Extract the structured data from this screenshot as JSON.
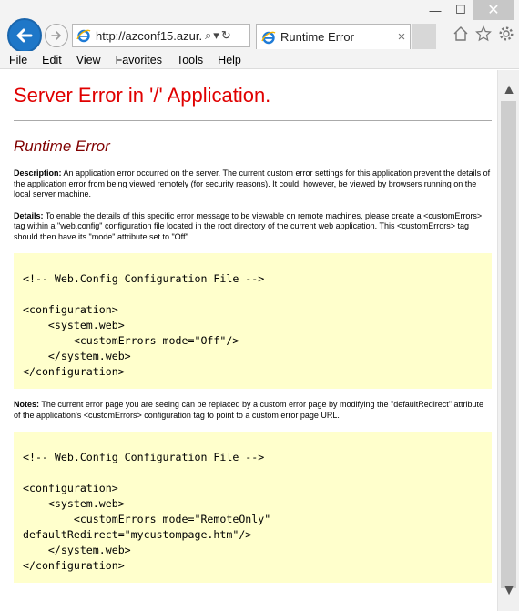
{
  "window": {
    "minimize_glyph": "—",
    "maximize_glyph": "☐",
    "close_glyph": "✕"
  },
  "address_bar": {
    "url": "http://azconf15.azur...",
    "search_glyph": "⌕",
    "dropdown_glyph": "▾",
    "refresh_glyph": "↻"
  },
  "tab": {
    "title": "Runtime Error",
    "close_glyph": "×"
  },
  "menu": {
    "items": [
      "File",
      "Edit",
      "View",
      "Favorites",
      "Tools",
      "Help"
    ]
  },
  "page": {
    "heading": "Server Error in '/' Application.",
    "subheading": "Runtime Error",
    "description_label": "Description:",
    "description_text": " An application error occurred on the server. The current custom error settings for this application prevent the details of the application error from being viewed remotely (for security reasons). It could, however, be viewed by browsers running on the local server machine.",
    "details_label": "Details:",
    "details_text": " To enable the details of this specific error message to be viewable on remote machines, please create a <customErrors> tag within a \"web.config\" configuration file located in the root directory of the current web application. This <customErrors> tag should then have its \"mode\" attribute set to \"Off\".",
    "code1": "<!-- Web.Config Configuration File -->\n\n<configuration>\n    <system.web>\n        <customErrors mode=\"Off\"/>\n    </system.web>\n</configuration>",
    "notes_label": "Notes:",
    "notes_text": " The current error page you are seeing can be replaced by a custom error page by modifying the \"defaultRedirect\" attribute of the application's <customErrors> configuration tag to point to a custom error page URL.",
    "code2": "<!-- Web.Config Configuration File -->\n\n<configuration>\n    <system.web>\n        <customErrors mode=\"RemoteOnly\"\ndefaultRedirect=\"mycustompage.htm\"/>\n    </system.web>\n</configuration>"
  },
  "scrollbar": {
    "up_glyph": "▲",
    "down_glyph": "▼"
  },
  "colors": {
    "heading": "#e00000",
    "subheading": "#800000",
    "code_background": "#ffffcc",
    "back_button": "#1e77c8"
  }
}
